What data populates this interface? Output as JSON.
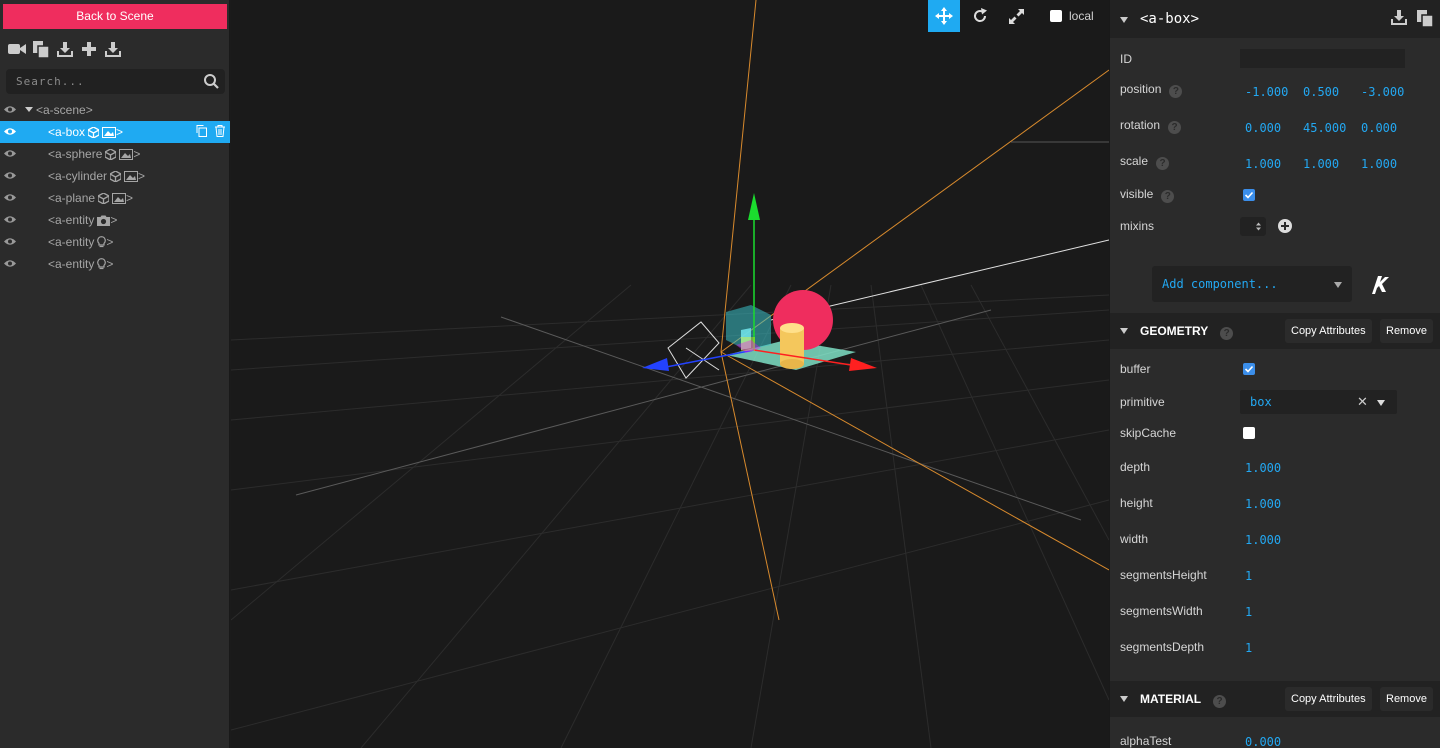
{
  "left_panel": {
    "back_label": "Back to Scene",
    "toolbar_icons": [
      "camera-icon",
      "copy-icon",
      "download-icon",
      "plus-icon",
      "download-icon"
    ],
    "search_placeholder": "Search...",
    "tree": [
      {
        "label": "<a-scene>",
        "selected": false
      },
      {
        "label": "<a-box",
        "suffix": ">",
        "selected": true
      },
      {
        "label": "<a-sphere",
        "suffix": ">",
        "selected": false
      },
      {
        "label": "<a-cylinder",
        "suffix": ">",
        "selected": false
      },
      {
        "label": "<a-plane",
        "suffix": ">",
        "selected": false
      },
      {
        "label": "<a-entity",
        "suffix": ">",
        "selected": false
      },
      {
        "label": "<a-entity",
        "suffix": ">",
        "selected": false
      },
      {
        "label": "<a-entity",
        "suffix": ">",
        "selected": false
      }
    ]
  },
  "viewport": {
    "local_label": "local",
    "tools": [
      "translate-icon",
      "rotate-icon",
      "scale-icon"
    ],
    "active_tool": "translate-icon"
  },
  "inspector": {
    "title": "<a-box>",
    "id_label": "ID",
    "id_value": "",
    "position_label": "position",
    "position": [
      "-1.000",
      "0.500",
      "-3.000"
    ],
    "rotation_label": "rotation",
    "rotation": [
      "0.000",
      "45.000",
      "0.000"
    ],
    "scale_label": "scale",
    "scale": [
      "1.000",
      "1.000",
      "1.000"
    ],
    "visible_label": "visible",
    "visible": true,
    "mixins_label": "mixins",
    "add_component": "Add component...",
    "geometry": {
      "title": "GEOMETRY",
      "copy_label": "Copy Attributes",
      "remove_label": "Remove",
      "buffer_label": "buffer",
      "buffer": true,
      "primitive_label": "primitive",
      "primitive": "box",
      "skipcache_label": "skipCache",
      "skipcache": false,
      "depth_label": "depth",
      "depth": "1.000",
      "height_label": "height",
      "height": "1.000",
      "width_label": "width",
      "width": "1.000",
      "seg_h_label": "segmentsHeight",
      "seg_h": "1",
      "seg_w_label": "segmentsWidth",
      "seg_w": "1",
      "seg_d_label": "segmentsDepth",
      "seg_d": "1"
    },
    "material": {
      "title": "MATERIAL",
      "copy_label": "Copy Attributes",
      "remove_label": "Remove",
      "alphatest_label": "alphaTest",
      "alphatest": "0.000"
    }
  },
  "colors": {
    "accent": "#1faaf2",
    "back_button": "#ef2d5e",
    "value_text": "#23a8f2"
  }
}
